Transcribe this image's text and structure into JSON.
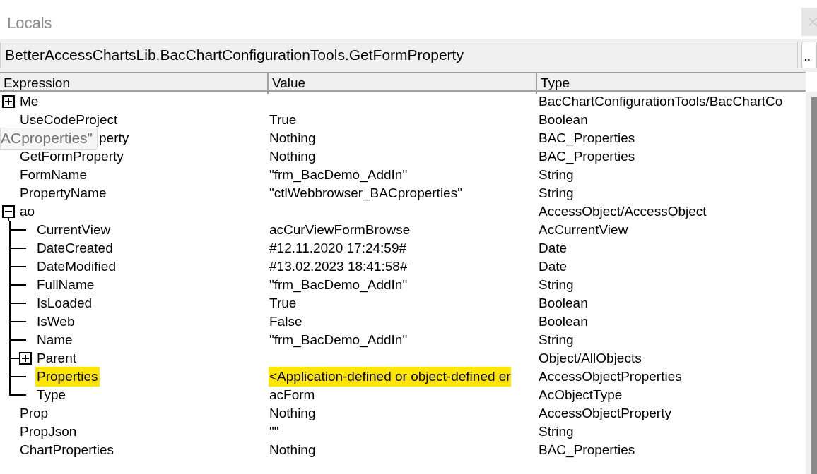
{
  "window": {
    "title": "Locals"
  },
  "context": {
    "value": "BetterAccessChartsLib.BacChartConfigurationTools.GetFormProperty",
    "button": ".."
  },
  "columns": [
    "Expression",
    "Value",
    "Type"
  ],
  "rows": [
    {
      "expression": "Me",
      "type": "BacChartConfigurationTools/BacChartCo",
      "expanded": false,
      "highlighted": false
    },
    {
      "expression": "UseCodeProject",
      "value": "True",
      "type": "Boolean",
      "highlighted": false
    },
    {
      "expression": "perty",
      "tooltip": "ACproperties\"",
      "value": "Nothing",
      "type": "BAC_Properties",
      "highlighted": false
    },
    {
      "expression": "GetFormProperty",
      "value": "Nothing",
      "type": "BAC_Properties",
      "highlighted": false
    },
    {
      "expression": "FormName",
      "value": "\"frm_BacDemo_AddIn\"",
      "type": "String",
      "highlighted": false
    },
    {
      "expression": "PropertyName",
      "value": "\"ctlWebbrowser_BACproperties\"",
      "type": "String",
      "highlighted": false
    },
    {
      "expression": "ao",
      "type": "AccessObject/AccessObject",
      "expanded": true,
      "highlighted": false,
      "children": [
        {
          "expression": "CurrentView",
          "value": "acCurViewFormBrowse",
          "type": "AcCurrentView",
          "highlighted": false
        },
        {
          "expression": "DateCreated",
          "value": "#12.11.2020 17:24:59#",
          "type": "Date",
          "highlighted": false
        },
        {
          "expression": "DateModified",
          "value": "#13.02.2023 18:41:58#",
          "type": "Date",
          "highlighted": false
        },
        {
          "expression": "FullName",
          "value": "\"frm_BacDemo_AddIn\"",
          "type": "String",
          "highlighted": false
        },
        {
          "expression": "IsLoaded",
          "value": "True",
          "type": "Boolean",
          "highlighted": false
        },
        {
          "expression": "IsWeb",
          "value": "False",
          "type": "Boolean",
          "highlighted": false
        },
        {
          "expression": "Name",
          "value": "\"frm_BacDemo_AddIn\"",
          "type": "String",
          "highlighted": false
        },
        {
          "expression": "Parent",
          "type": "Object/AllObjects",
          "expanded": false,
          "highlighted": false
        },
        {
          "expression": "Properties",
          "value": "<Application-defined or object-defined er",
          "type": "AccessObjectProperties",
          "highlighted": true
        },
        {
          "expression": "Type",
          "value": "acForm",
          "type": "AcObjectType",
          "highlighted": false
        }
      ]
    },
    {
      "expression": "Prop",
      "value": "Nothing",
      "type": "AccessObjectProperty",
      "highlighted": false
    },
    {
      "expression": "PropJson",
      "value": "\"\"",
      "type": "String",
      "highlighted": false
    },
    {
      "expression": "ChartProperties",
      "value": "Nothing",
      "type": "BAC_Properties",
      "highlighted": false
    }
  ]
}
